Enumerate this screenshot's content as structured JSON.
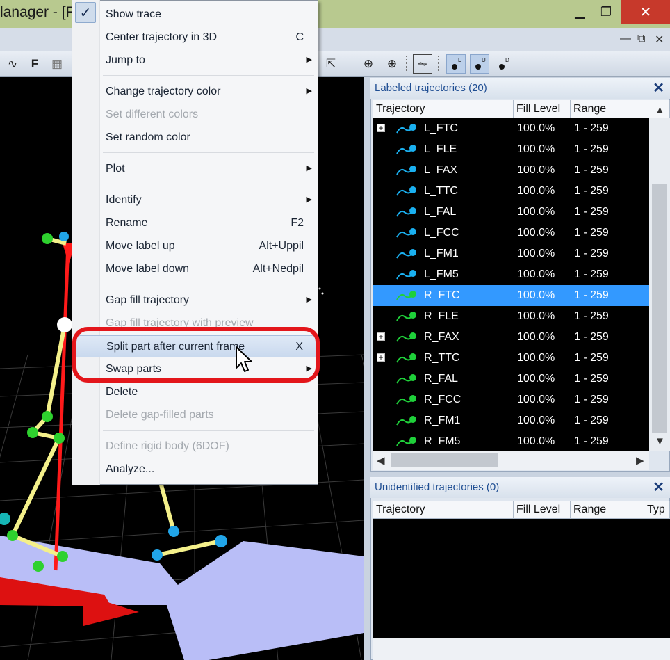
{
  "window": {
    "title": "lanager - [F",
    "minimize_glyph": "▁",
    "maximize_glyph": "❐",
    "close_glyph": "✕"
  },
  "mdi": {
    "minimize_glyph": "—",
    "restore_glyph": "⧉",
    "close_glyph": "✕"
  },
  "toolbar": {
    "trajectory_tool_glyph": "∿",
    "f_label": "F",
    "grid_tool_glyph": "▦",
    "select_tool_glyph": "⇱",
    "center_tool_glyph": "⊕",
    "add_tool_glyph": "⊕",
    "plot_tool_glyph": "⏦",
    "label_l": "L",
    "label_u": "U",
    "label_d": "D"
  },
  "context_menu": {
    "items": [
      {
        "label": "Show trace",
        "shortcut": "",
        "submenu": false,
        "disabled": false,
        "checked": true
      },
      {
        "label": "Center trajectory in 3D",
        "shortcut": "C",
        "submenu": false,
        "disabled": false
      },
      {
        "label": "Jump to",
        "shortcut": "",
        "submenu": true,
        "disabled": false
      },
      {
        "label": "Change trajectory color",
        "shortcut": "",
        "submenu": true,
        "disabled": false
      },
      {
        "label": "Set different colors",
        "shortcut": "",
        "submenu": false,
        "disabled": true
      },
      {
        "label": "Set random color",
        "shortcut": "",
        "submenu": false,
        "disabled": false
      },
      {
        "label": "Plot",
        "shortcut": "",
        "submenu": true,
        "disabled": false
      },
      {
        "label": "Identify",
        "shortcut": "",
        "submenu": true,
        "disabled": false
      },
      {
        "label": "Rename",
        "shortcut": "F2",
        "submenu": false,
        "disabled": false
      },
      {
        "label": "Move label up",
        "shortcut": "Alt+Uppil",
        "submenu": false,
        "disabled": false
      },
      {
        "label": "Move label down",
        "shortcut": "Alt+Nedpil",
        "submenu": false,
        "disabled": false
      },
      {
        "label": "Gap fill trajectory",
        "shortcut": "",
        "submenu": true,
        "disabled": false
      },
      {
        "label": "Gap fill trajectory with preview",
        "shortcut": "",
        "submenu": false,
        "disabled": true
      },
      {
        "label": "Split part after current frame",
        "shortcut": "X",
        "submenu": false,
        "disabled": false,
        "hover": true
      },
      {
        "label": "Swap parts",
        "shortcut": "",
        "submenu": true,
        "disabled": false
      },
      {
        "label": "Delete",
        "shortcut": "",
        "submenu": false,
        "disabled": false
      },
      {
        "label": "Delete gap-filled parts",
        "shortcut": "",
        "submenu": false,
        "disabled": true
      },
      {
        "label": "Define rigid body (6DOF)",
        "shortcut": "",
        "submenu": false,
        "disabled": true
      },
      {
        "label": "Analyze...",
        "shortcut": "",
        "submenu": false,
        "disabled": false
      }
    ],
    "check_glyph": "✓",
    "submenu_glyph": "▶"
  },
  "labeled_panel": {
    "title": "Labeled trajectories (20)",
    "close_glyph": "✕",
    "columns": [
      "Trajectory",
      "Fill Level",
      "Range",
      ""
    ],
    "rows": [
      {
        "name": "L_FTC",
        "fill": "100.0%",
        "range": "1 - 259",
        "expandable": true,
        "color": "#1ab0f0",
        "selected": false
      },
      {
        "name": "L_FLE",
        "fill": "100.0%",
        "range": "1 - 259",
        "expandable": false,
        "color": "#1ab0f0",
        "selected": false
      },
      {
        "name": "L_FAX",
        "fill": "100.0%",
        "range": "1 - 259",
        "expandable": false,
        "color": "#1ab0f0",
        "selected": false
      },
      {
        "name": "L_TTC",
        "fill": "100.0%",
        "range": "1 - 259",
        "expandable": false,
        "color": "#1ab0f0",
        "selected": false
      },
      {
        "name": "L_FAL",
        "fill": "100.0%",
        "range": "1 - 259",
        "expandable": false,
        "color": "#1ab0f0",
        "selected": false
      },
      {
        "name": "L_FCC",
        "fill": "100.0%",
        "range": "1 - 259",
        "expandable": false,
        "color": "#1ab0f0",
        "selected": false
      },
      {
        "name": "L_FM1",
        "fill": "100.0%",
        "range": "1 - 259",
        "expandable": false,
        "color": "#1ab0f0",
        "selected": false
      },
      {
        "name": "L_FM5",
        "fill": "100.0%",
        "range": "1 - 259",
        "expandable": false,
        "color": "#1ab0f0",
        "selected": false
      },
      {
        "name": "R_FTC",
        "fill": "100.0%",
        "range": "1 - 259",
        "expandable": false,
        "color": "#1fd03a",
        "selected": true
      },
      {
        "name": "R_FLE",
        "fill": "100.0%",
        "range": "1 - 259",
        "expandable": false,
        "color": "#1fd03a",
        "selected": false
      },
      {
        "name": "R_FAX",
        "fill": "100.0%",
        "range": "1 - 259",
        "expandable": true,
        "color": "#1fd03a",
        "selected": false
      },
      {
        "name": "R_TTC",
        "fill": "100.0%",
        "range": "1 - 259",
        "expandable": true,
        "color": "#1fd03a",
        "selected": false
      },
      {
        "name": "R_FAL",
        "fill": "100.0%",
        "range": "1 - 259",
        "expandable": false,
        "color": "#1fd03a",
        "selected": false
      },
      {
        "name": "R_FCC",
        "fill": "100.0%",
        "range": "1 - 259",
        "expandable": false,
        "color": "#1fd03a",
        "selected": false
      },
      {
        "name": "R_FM1",
        "fill": "100.0%",
        "range": "1 - 259",
        "expandable": false,
        "color": "#1fd03a",
        "selected": false
      },
      {
        "name": "R_FM5",
        "fill": "100.0%",
        "range": "1 - 259",
        "expandable": false,
        "color": "#1fd03a",
        "selected": false
      }
    ],
    "expand_glyph": "+",
    "scroll_up": "▲",
    "scroll_down": "▼",
    "scroll_left": "◀",
    "scroll_right": "▶"
  },
  "unidentified_panel": {
    "title": "Unidentified trajectories (0)",
    "close_glyph": "✕",
    "columns": [
      "Trajectory",
      "Fill Level",
      "Range",
      "Typ"
    ]
  },
  "colors": {
    "selected_row": "#3399ff",
    "highlight_ring": "#e3161b",
    "left_marker": "#1ab0f0",
    "right_marker": "#1fd03a"
  }
}
